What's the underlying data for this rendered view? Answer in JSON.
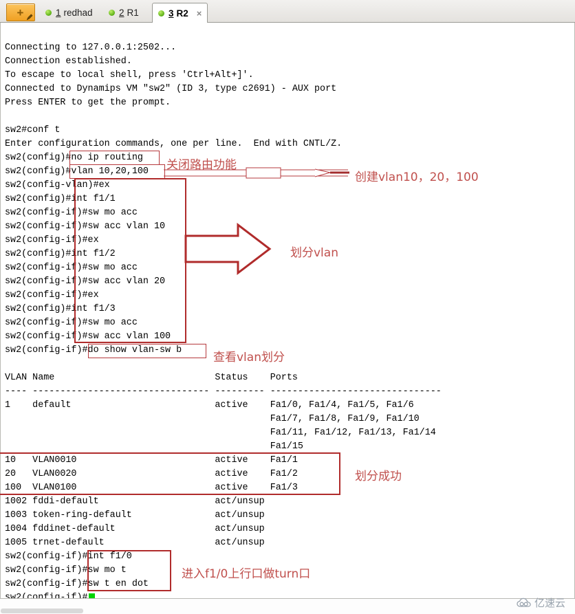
{
  "window": {
    "new_tab_button": "new-tab-button",
    "tabs": [
      {
        "num": "1",
        "label": "redhad",
        "active": false,
        "led": "green"
      },
      {
        "num": "2",
        "label": "R1",
        "active": false,
        "led": "green"
      },
      {
        "num": "3",
        "label": "R2",
        "active": true,
        "led": "green",
        "close": "×"
      }
    ]
  },
  "terminal": {
    "lines": [
      "Connecting to 127.0.0.1:2502...",
      "Connection established.",
      "To escape to local shell, press 'Ctrl+Alt+]'.",
      "Connected to Dynamips VM \"sw2\" (ID 3, type c2691) - AUX port",
      "Press ENTER to get the prompt.",
      "",
      "sw2#conf t",
      "Enter configuration commands, one per line.  End with CNTL/Z.",
      "sw2(config)#no ip routing",
      "sw2(config)#vlan 10,20,100",
      "sw2(config-vlan)#ex",
      "sw2(config)#int f1/1",
      "sw2(config-if)#sw mo acc",
      "sw2(config-if)#sw acc vlan 10",
      "sw2(config-if)#ex",
      "sw2(config)#int f1/2",
      "sw2(config-if)#sw mo acc",
      "sw2(config-if)#sw acc vlan 20",
      "sw2(config-if)#ex",
      "sw2(config)#int f1/3",
      "sw2(config-if)#sw mo acc",
      "sw2(config-if)#sw acc vlan 100",
      "sw2(config-if)#do show vlan-sw b",
      "",
      "VLAN Name                             Status    Ports",
      "---- -------------------------------- --------- -------------------------------",
      "1    default                          active    Fa1/0, Fa1/4, Fa1/5, Fa1/6",
      "                                                Fa1/7, Fa1/8, Fa1/9, Fa1/10",
      "                                                Fa1/11, Fa1/12, Fa1/13, Fa1/14",
      "                                                Fa1/15",
      "10   VLAN0010                         active    Fa1/1",
      "20   VLAN0020                         active    Fa1/2",
      "100  VLAN0100                         active    Fa1/3",
      "1002 fddi-default                     act/unsup",
      "1003 token-ring-default               act/unsup",
      "1004 fddinet-default                  act/unsup",
      "1005 trnet-default                    act/unsup",
      "sw2(config-if)#int f1/0",
      "sw2(config-if)#sw mo t",
      "sw2(config-if)#sw t en dot",
      "sw2(config-if)#"
    ]
  },
  "annotations": {
    "accent_color": "#b02b2b",
    "text_color": "#c0504d",
    "items": [
      {
        "id": "no-ip-routing-note",
        "text": "关闭路由功能"
      },
      {
        "id": "create-vlan-note",
        "text": "创建vlan10，20，100"
      },
      {
        "id": "assign-vlan-note",
        "text": "划分vlan"
      },
      {
        "id": "show-vlan-note",
        "text": "查看vlan划分"
      },
      {
        "id": "assign-success-note",
        "text": "划分成功"
      },
      {
        "id": "trunk-note",
        "text": "进入f1/0上行口做turn口"
      }
    ]
  },
  "watermark": {
    "text": "亿速云"
  }
}
